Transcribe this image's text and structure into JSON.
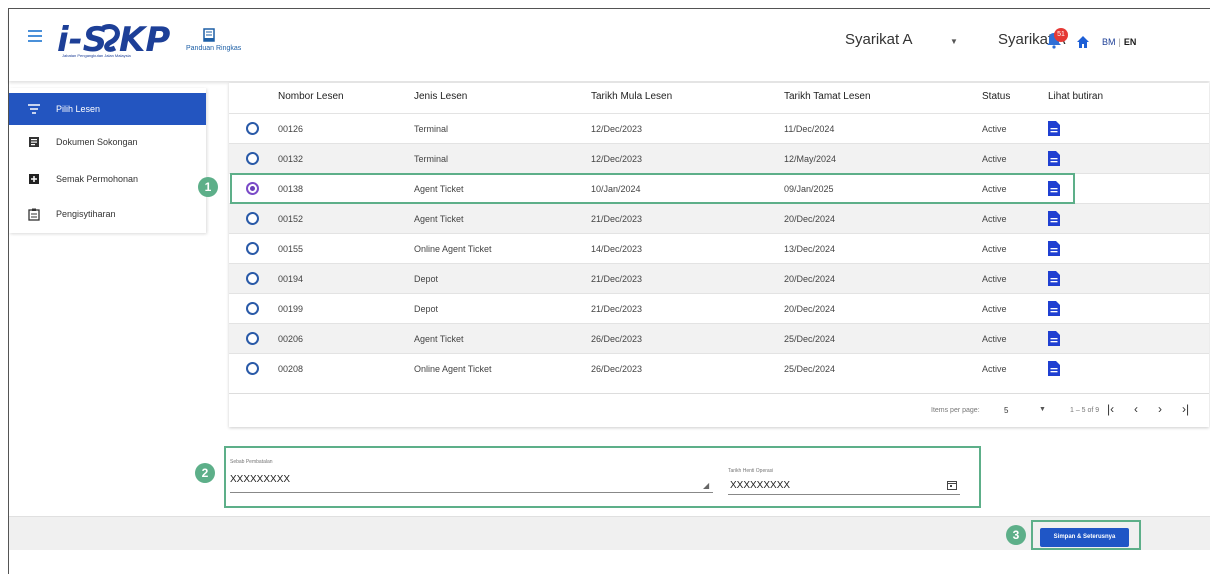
{
  "header": {
    "logo_text": "i-SPKP",
    "logo_subtitle": "Jabatan Pengangkutan Jalan Malaysia",
    "guide_label": "Panduan Ringkas",
    "company_select_value": "Syarikat A",
    "company_name": "Syarikat A",
    "notification_count": "51",
    "lang_bm": "BM",
    "lang_sep": "|",
    "lang_en": "EN"
  },
  "sidebar": {
    "items": [
      {
        "label": "Pilih Lesen",
        "icon": "filter-icon",
        "active": true
      },
      {
        "label": "Dokumen Sokongan",
        "icon": "documents-icon",
        "active": false
      },
      {
        "label": "Semak Permohonan",
        "icon": "review-icon",
        "active": false
      },
      {
        "label": "Pengisytiharan",
        "icon": "clipboard-icon",
        "active": false
      }
    ]
  },
  "table": {
    "headers": [
      "Nombor Lesen",
      "Jenis Lesen",
      "Tarikh Mula Lesen",
      "Tarikh Tamat Lesen",
      "Status",
      "Lihat butiran"
    ],
    "rows": [
      {
        "no": "00126",
        "type": "Terminal",
        "start": "12/Dec/2023",
        "end": "11/Dec/2024",
        "status": "Active",
        "selected": false
      },
      {
        "no": "00132",
        "type": "Terminal",
        "start": "12/Dec/2023",
        "end": "12/May/2024",
        "status": "Active",
        "selected": false
      },
      {
        "no": "00138",
        "type": "Agent Ticket",
        "start": "10/Jan/2024",
        "end": "09/Jan/2025",
        "status": "Active",
        "selected": true
      },
      {
        "no": "00152",
        "type": "Agent Ticket",
        "start": "21/Dec/2023",
        "end": "20/Dec/2024",
        "status": "Active",
        "selected": false
      },
      {
        "no": "00155",
        "type": "Online Agent Ticket",
        "start": "14/Dec/2023",
        "end": "13/Dec/2024",
        "status": "Active",
        "selected": false
      },
      {
        "no": "00194",
        "type": "Depot",
        "start": "21/Dec/2023",
        "end": "20/Dec/2024",
        "status": "Active",
        "selected": false
      },
      {
        "no": "00199",
        "type": "Depot",
        "start": "21/Dec/2023",
        "end": "20/Dec/2024",
        "status": "Active",
        "selected": false
      },
      {
        "no": "00206",
        "type": "Agent Ticket",
        "start": "26/Dec/2023",
        "end": "25/Dec/2024",
        "status": "Active",
        "selected": false
      },
      {
        "no": "00208",
        "type": "Online Agent Ticket",
        "start": "26/Dec/2023",
        "end": "25/Dec/2024",
        "status": "Active",
        "selected": false
      }
    ],
    "paginator": {
      "items_per_page_label": "Items per page:",
      "items_per_page_value": "5",
      "range_label": "1 – 5 of 9"
    }
  },
  "form": {
    "reason_label": "Sebab Pembatalan",
    "reason_value": "XXXXXXXXX",
    "stop_date_label": "Tarikh Henti Operasi",
    "stop_date_value": "XXXXXXXXX"
  },
  "actions": {
    "save_next_label": "Simpan & Seterusnya"
  },
  "annotations": {
    "marker_1": "1",
    "marker_2": "2",
    "marker_3": "3"
  },
  "colors": {
    "brand_blue": "#2355c0",
    "highlight_green": "#5daf89",
    "badge_red": "#e53935",
    "doc_icon_blue": "#1f3fd1"
  }
}
